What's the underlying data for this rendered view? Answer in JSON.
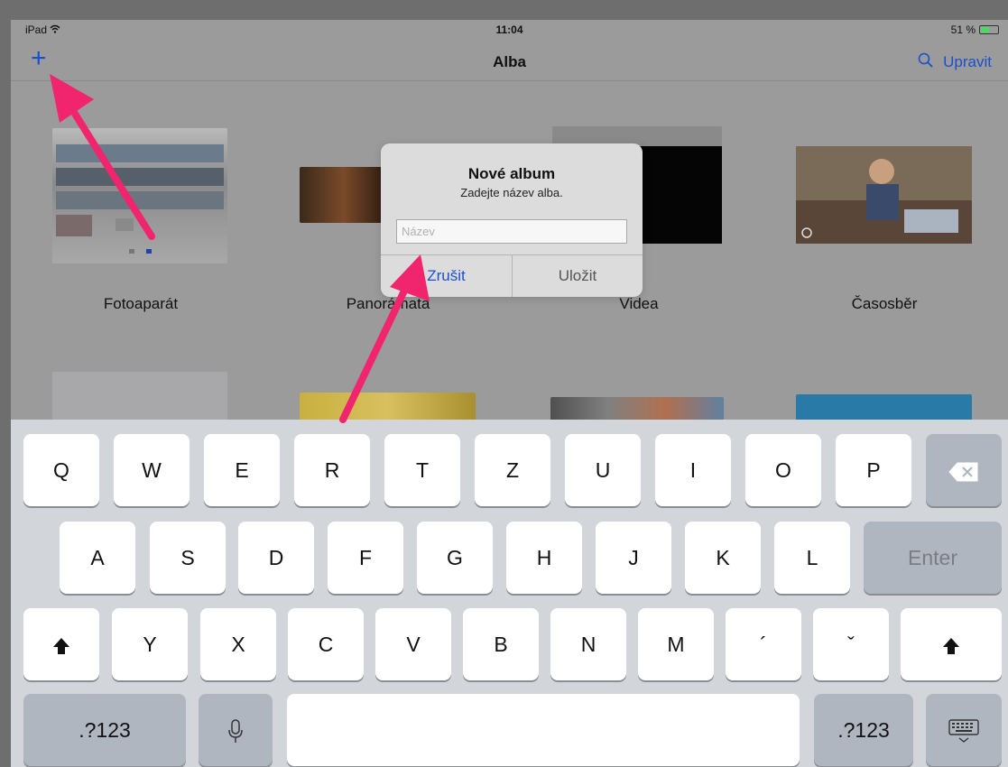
{
  "status_bar": {
    "device": "iPad",
    "time": "11:04",
    "battery": "51 %",
    "battery_level": 0.51
  },
  "nav": {
    "add_icon": "plus-icon",
    "title": "Alba",
    "search_icon": "search-icon",
    "edit_label": "Upravit"
  },
  "albums": [
    {
      "label": "Fotoaparát"
    },
    {
      "label": "Panorámata"
    },
    {
      "label": "Videa"
    },
    {
      "label": "Časosběr"
    }
  ],
  "dialog": {
    "title": "Nové album",
    "message": "Zadejte název alba.",
    "placeholder": "Název",
    "cancel_label": "Zrušit",
    "save_label": "Uložit"
  },
  "keyboard": {
    "row1": [
      "Q",
      "W",
      "E",
      "R",
      "T",
      "Z",
      "U",
      "I",
      "O",
      "P"
    ],
    "row2": [
      "A",
      "S",
      "D",
      "F",
      "G",
      "H",
      "J",
      "K",
      "L"
    ],
    "enter_label": "Enter",
    "row3": [
      "Y",
      "X",
      "C",
      "V",
      "B",
      "N",
      "M",
      "´",
      "ˇ"
    ],
    "numbers_label": ".?123",
    "icons": {
      "backspace": "backspace-icon",
      "shift": "shift-icon",
      "mic": "microphone-icon",
      "hide": "keyboard-hide-icon"
    }
  },
  "annotation": {
    "arrow_color": "#f0256e"
  },
  "colors": {
    "accent": "#1a4fd0",
    "arrow": "#f0256e"
  }
}
